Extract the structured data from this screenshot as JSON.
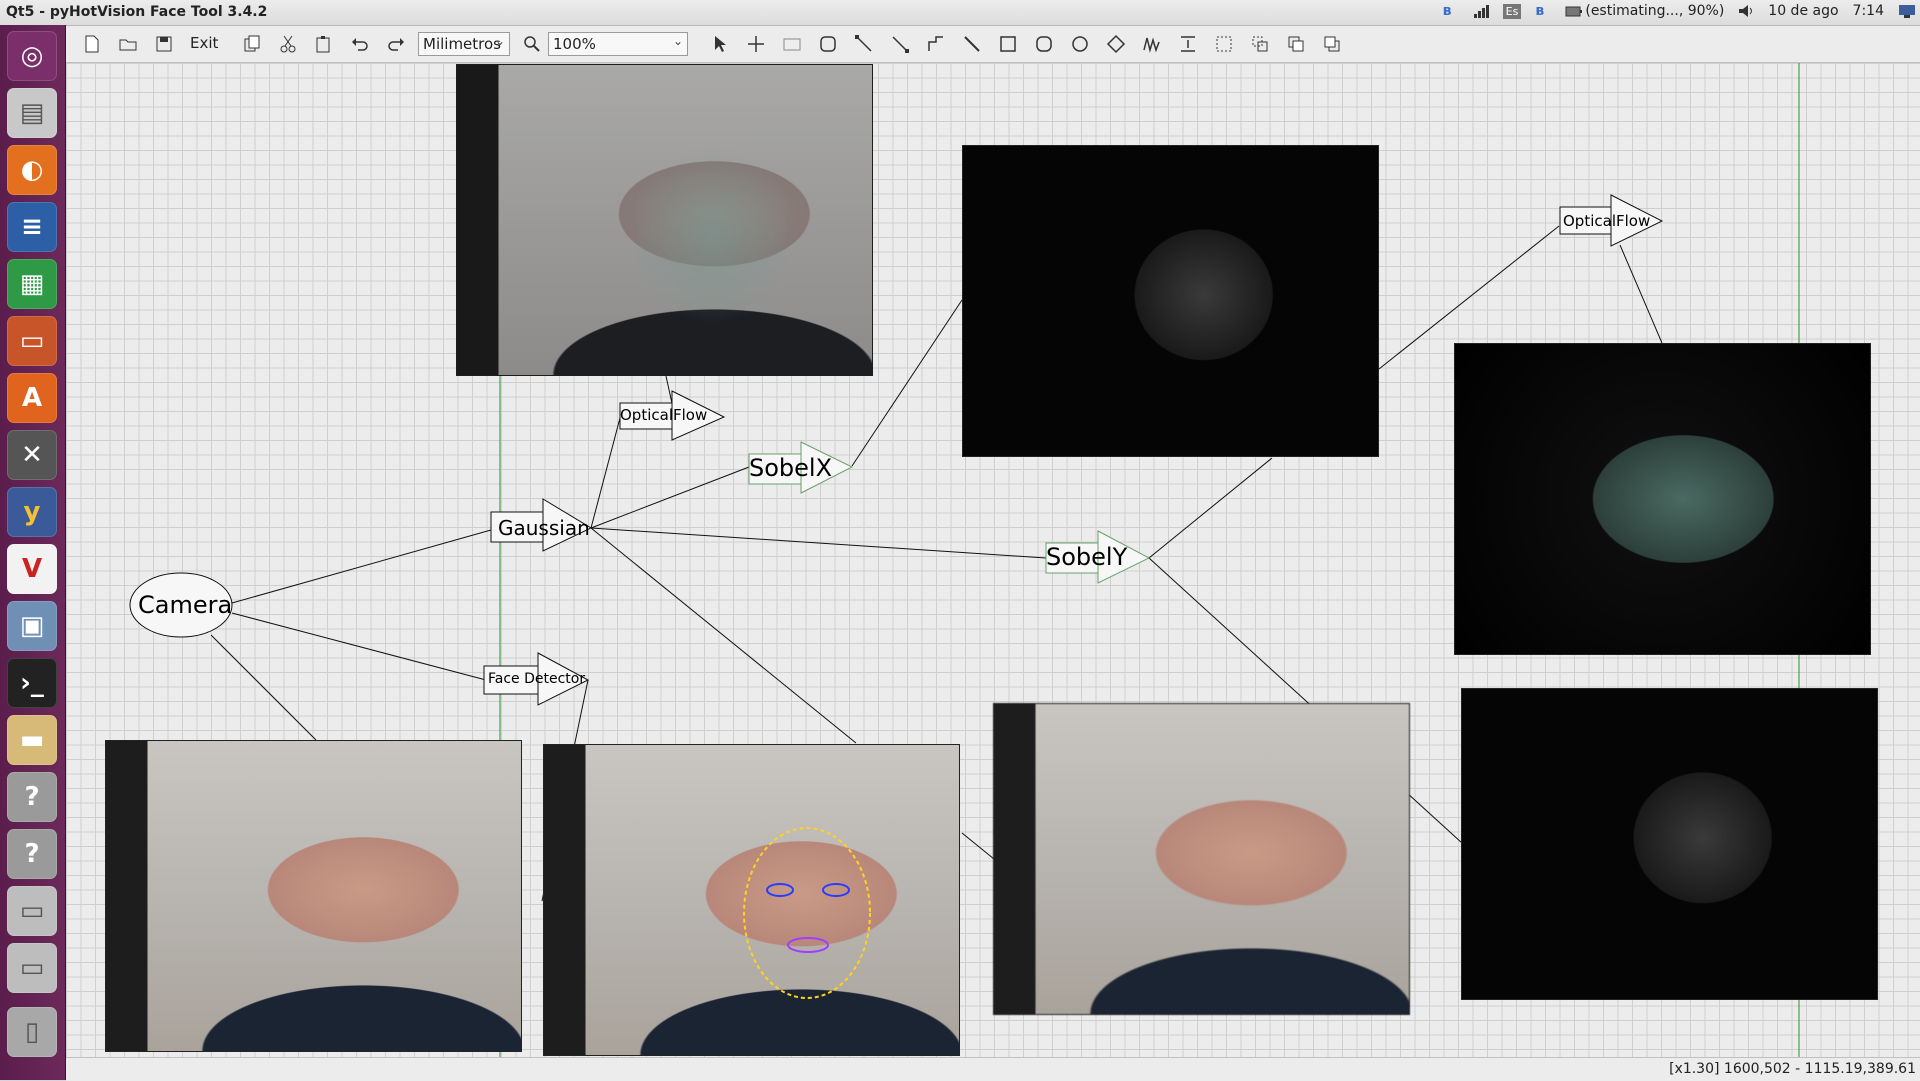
{
  "window": {
    "title": "Qt5 - pyHotVision Face Tool 3.4.2"
  },
  "panel": {
    "keyboard_layout": "Es",
    "battery_text": "(estimating..., 90%)",
    "date": "10 de ago",
    "time": "7:14"
  },
  "toolbar": {
    "exit_label": "Exit",
    "units_value": "Milimetros",
    "zoom_value": "100%"
  },
  "launcher": {
    "items": [
      "ubuntu-icon",
      "files-icon",
      "firefox-icon",
      "writer-icon",
      "calc-icon",
      "impress-icon",
      "software-center-icon",
      "settings-icon",
      "yed-icon",
      "vnc-icon",
      "remote-desktop-icon",
      "terminal-icon",
      "folder-icon",
      "help-icon",
      "help-icon",
      "drive-icon",
      "drive-icon",
      "trash-icon"
    ]
  },
  "nodes": {
    "camera": "Camera",
    "gaussian": "Gaussian",
    "opticalflow_1": "OpticalFlow",
    "sobelx": "SobelX",
    "sobely": "SobelY",
    "opticalflow_2": "OpticalFlow",
    "face_detector": "Face Detector"
  },
  "status": {
    "text": "[x1.30] 1600,502 - 1115.19,389.61"
  }
}
